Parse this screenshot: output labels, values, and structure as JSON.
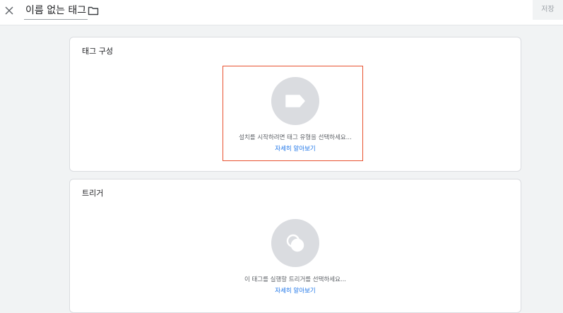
{
  "header": {
    "title": "이름 없는 태그",
    "save_label": "저장",
    "close_icon": "close-icon",
    "folder_icon": "folder-icon"
  },
  "tag_config": {
    "title": "태그 구성",
    "hint": "설치를 시작하려면 태그 유형을 선택하세요...",
    "learn_more": "자세히 알아보기",
    "icon": "tag-icon"
  },
  "trigger": {
    "title": "트리거",
    "hint": "이 태그를 실행할 트리거를 선택하세요...",
    "learn_more": "자세히 알아보기",
    "icon": "trigger-icon"
  },
  "colors": {
    "highlight": "#e8512f",
    "link": "#1a73e8",
    "placeholder": "#dadce0"
  }
}
